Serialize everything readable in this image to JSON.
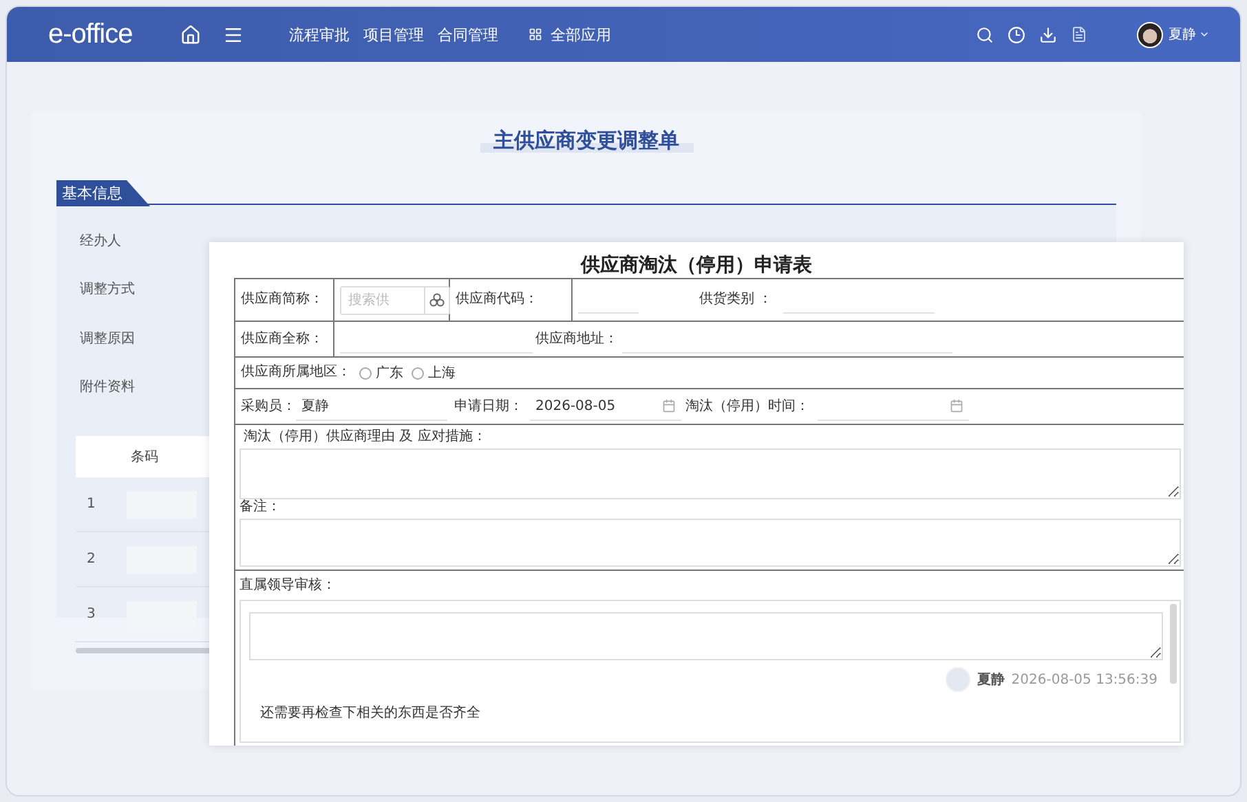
{
  "header": {
    "logo": "e-office",
    "nav": [
      "流程审批",
      "项目管理",
      "合同管理"
    ],
    "all_apps": "全部应用",
    "user": "夏静"
  },
  "background_form": {
    "title": "主供应商变更调整单",
    "section": "基本信息",
    "fields": [
      "经办人",
      "调整方式",
      "调整原因",
      "附件资料"
    ],
    "table": {
      "columns": [
        "条码"
      ],
      "rows": [
        "1",
        "2",
        "3"
      ]
    }
  },
  "dialog": {
    "title": "供应商淘汰（停用）申请表",
    "short_name": {
      "label": "供应商简称：",
      "placeholder": "搜索供"
    },
    "code": {
      "label": "供应商代码："
    },
    "category": {
      "label": "供货类别 ："
    },
    "full_name": {
      "label": "供应商全称："
    },
    "address": {
      "label": "供应商地址："
    },
    "region": {
      "label": "供应商所属地区：",
      "options": [
        {
          "label": "广东",
          "selected": false
        },
        {
          "label": "上海",
          "selected": false
        }
      ]
    },
    "buyer": {
      "label": "采购员：",
      "value": "夏静"
    },
    "apply_date": {
      "label": "申请日期：",
      "value": "2026-08-05"
    },
    "stop_date": {
      "label": "淘汰（停用）时间："
    },
    "reason": {
      "label": "淘汰（停用）供应商理由 及 应对措施："
    },
    "remark": {
      "label": "备注："
    },
    "review": {
      "label": "直属领导审核：",
      "comments": [
        {
          "user": "夏静",
          "time": "2026-08-05 13:56:39"
        }
      ],
      "comment_text": "还需要再检查下相关的东西是否齐全"
    }
  }
}
